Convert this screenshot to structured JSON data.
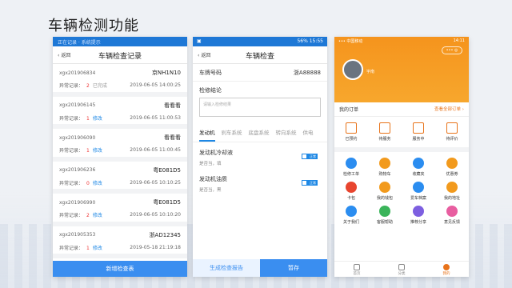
{
  "title": "车辆检测功能",
  "p1": {
    "status": "正在记录 · 系统提示",
    "back": "返回",
    "title": "车辆检查记录",
    "records": [
      {
        "no": "xgx201906834",
        "plate": "京NH1N10",
        "label": "异常记录：",
        "count": "2",
        "state": "已完成",
        "date": "2019-06-05 14:00:25",
        "done": true
      },
      {
        "no": "xgx201906145",
        "plate": "看看看",
        "label": "异常记录：",
        "count": "1",
        "state": "修改",
        "date": "2019-06-05 11:00:53",
        "done": false
      },
      {
        "no": "xgx201906090",
        "plate": "看看看",
        "label": "异常记录：",
        "count": "1",
        "state": "修改",
        "date": "2019-06-05 11:00:45",
        "done": false
      },
      {
        "no": "xgx201906236",
        "plate": "粤E081D5",
        "label": "异常记录：",
        "count": "0",
        "state": "修改",
        "date": "2019-06-05 10:10:25",
        "done": false
      },
      {
        "no": "xgx201906990",
        "plate": "粤E081D5",
        "label": "异常记录：",
        "count": "2",
        "state": "修改",
        "date": "2019-06-05 10:10:20",
        "done": false
      },
      {
        "no": "xgx201905353",
        "plate": "浙AD12345",
        "label": "异常记录：",
        "count": "1",
        "state": "修改",
        "date": "2019-05-18 21:19:18",
        "done": false
      }
    ],
    "add_button": "新增检查表"
  },
  "p2": {
    "status_left": "▣",
    "status_right": "56% 15:55",
    "back": "返回",
    "title": "车辆检查",
    "plate_label": "车牌号码",
    "plate_value": "浙A88888",
    "conclusion_label": "检修结论",
    "conclusion_placeholder": "请输入检修结果",
    "tabs": [
      "发动机",
      "刹车系统",
      "底盘系统",
      "转向系统",
      "供电"
    ],
    "items": [
      {
        "name": "发动机冷却液",
        "sub": "是否当，填",
        "toggle": "正常"
      },
      {
        "name": "发动机油质",
        "sub": "是否当，黑",
        "toggle": "正常"
      }
    ],
    "btn_report": "生成检查报告",
    "btn_save": "暂存"
  },
  "p3": {
    "status_left": "••• 中国移动",
    "status_right": "14:11",
    "pill": "••• ◎",
    "username": "宇南",
    "orders_title": "我的订单",
    "orders_all": "查看全部订单 ›",
    "order_items": [
      "已预约",
      "待服务",
      "服务中",
      "待评价"
    ],
    "tools": [
      {
        "label": "检修工单",
        "color": "blue"
      },
      {
        "label": "购物车",
        "color": "orange"
      },
      {
        "label": "收藏夹",
        "color": "blue"
      },
      {
        "label": "优惠券",
        "color": "orange"
      },
      {
        "label": "卡包",
        "color": "red"
      },
      {
        "label": "我的钱包",
        "color": "orange"
      },
      {
        "label": "爱车档案",
        "color": "blue"
      },
      {
        "label": "我的地址",
        "color": "orange"
      },
      {
        "label": "关于我们",
        "color": "blue"
      },
      {
        "label": "客服帮助",
        "color": "green"
      },
      {
        "label": "推荐分享",
        "color": "purple"
      },
      {
        "label": "意见反馈",
        "color": "pink"
      }
    ],
    "tabbar": [
      "首页",
      "分类",
      "我的"
    ]
  }
}
